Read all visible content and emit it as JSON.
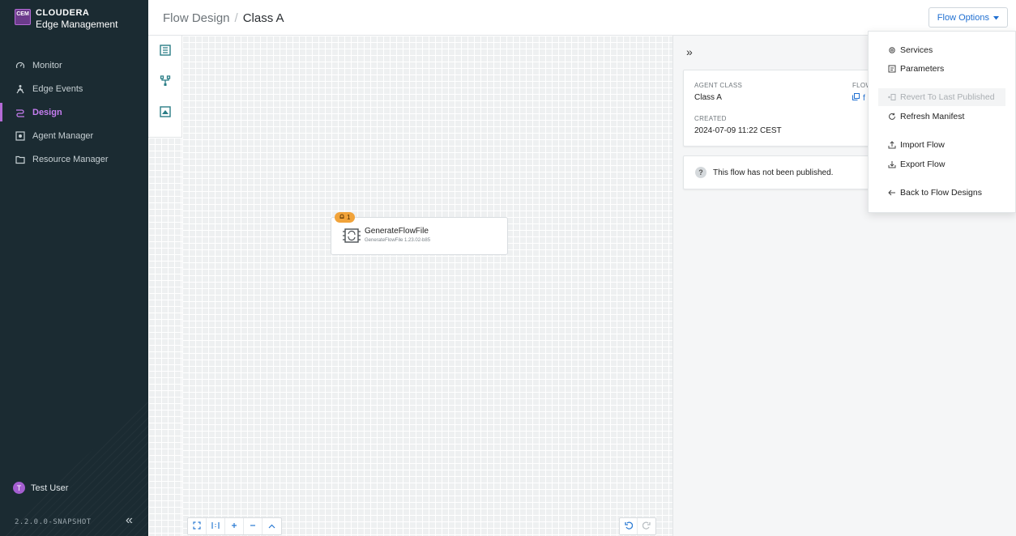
{
  "app": {
    "logo_badge": "CEM",
    "brand": "CLOUDERA",
    "product": "Edge Management",
    "accent_color": "#b46bd6"
  },
  "sidebar": {
    "items": [
      {
        "label": "Monitor",
        "icon": "gauge-icon"
      },
      {
        "label": "Edge Events",
        "icon": "person-icon"
      },
      {
        "label": "Design",
        "icon": "flow-icon",
        "active": true
      },
      {
        "label": "Agent Manager",
        "icon": "agent-icon"
      },
      {
        "label": "Resource Manager",
        "icon": "folder-icon"
      }
    ],
    "user_initial": "T",
    "user_name": "Test User",
    "version": "2.2.0.0-SNAPSHOT",
    "collapse_glyph": "«"
  },
  "header": {
    "crumb_root": "Flow Design",
    "crumb_sep": "/",
    "crumb_current": "Class A",
    "flow_options_label": "Flow Options"
  },
  "canvas": {
    "processor": {
      "badge": "1",
      "title": "GenerateFlowFile",
      "subtitle": "GenerateFlowFile 1.23.02-b85"
    },
    "bottom_tools": [
      "fit-icon",
      "actual-size-icon",
      "zoom-in-icon",
      "zoom-out-icon",
      "up-icon"
    ],
    "undo_tools": [
      "undo-icon",
      "redo-icon"
    ]
  },
  "panel": {
    "collapse_glyph": "»",
    "agent_class_label": "AGENT CLASS",
    "agent_class_value": "Class A",
    "flow_label": "FLOW",
    "flow_value": "f",
    "created_label": "CREATED",
    "created_value": "2024-07-09 11:22 CEST",
    "publish_status": "This flow has not been published."
  },
  "dropdown": {
    "items": [
      {
        "label": "Services",
        "icon": "gear-icon"
      },
      {
        "label": "Parameters",
        "icon": "parameters-icon"
      },
      {
        "label": "Revert To Last Published",
        "icon": "revert-icon",
        "disabled": true
      },
      {
        "label": "Refresh Manifest",
        "icon": "refresh-icon"
      },
      {
        "label": "Import Flow",
        "icon": "upload-icon"
      },
      {
        "label": "Export Flow",
        "icon": "download-icon"
      },
      {
        "label": "Back to Flow Designs",
        "icon": "arrow-left-icon"
      }
    ]
  }
}
